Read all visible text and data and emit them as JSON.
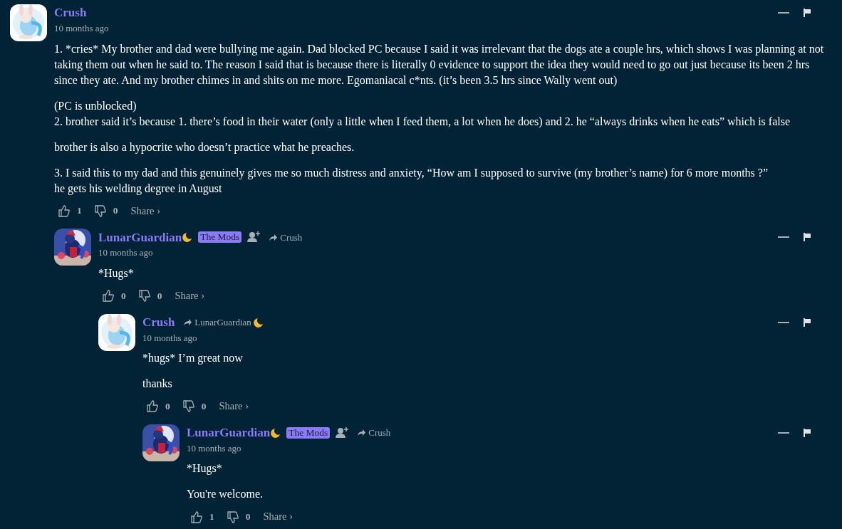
{
  "comments": [
    {
      "author": {
        "name": "Crush",
        "moon": false
      },
      "follow": false,
      "time": "10 months ago",
      "paragraphs": [
        "1. *cries* My brother and dad were bullying me again. Dad blocked PC because I said it was irrelevant that the dogs ate a couple hrs, which shows I was planning at not taking them out when he said to. The reason I said that is because there is literally 0 evidence to support the idea they would need to go out just because its been 2 hrs since they ate. And my brother chimes in and shits on me more. Egomaniacal c*nts. (it’s been 3.5 hrs since Wally went out)",
        "(PC is unblocked)\n2. brother said it’s because 1. there’s food in their water (only a little when I feed them, a lot when he does) and 2. he “always drinks when he eats” which is false",
        "brother is also a hypocrite who doesn’t practice what he preaches.",
        "3. I said this to my dad and this genuinely gives me so much distress and anxiety, “How am I supposed to survive (my brother’s name) for 6 more months ?”\nhe gets his welding degree in August"
      ],
      "likes": "1",
      "dislikes": "0",
      "share": "Share ›",
      "children": [
        {
          "author": {
            "name": "LunarGuardian",
            "moon": true
          },
          "badge": "The Mods",
          "follow": true,
          "reply_to": {
            "name": "Crush",
            "moon": false
          },
          "time": "10 months ago",
          "paragraphs": [
            "*Hugs*"
          ],
          "likes": "0",
          "dislikes": "0",
          "share": "Share ›",
          "children": [
            {
              "author": {
                "name": "Crush",
                "moon": false
              },
              "follow": false,
              "reply_to": {
                "name": "LunarGuardian",
                "moon": true
              },
              "time": "10 months ago",
              "paragraphs": [
                "*hugs* I’m great now",
                "thanks"
              ],
              "likes": "0",
              "dislikes": "0",
              "share": "Share ›",
              "children": [
                {
                  "author": {
                    "name": "LunarGuardian",
                    "moon": true
                  },
                  "badge": "The Mods",
                  "follow": true,
                  "reply_to": {
                    "name": "Crush",
                    "moon": false
                  },
                  "time": "10 months ago",
                  "paragraphs": [
                    "*Hugs*",
                    "You're welcome."
                  ],
                  "likes": "1",
                  "dislikes": "0",
                  "share": "Share ›"
                }
              ]
            }
          ]
        }
      ]
    }
  ]
}
